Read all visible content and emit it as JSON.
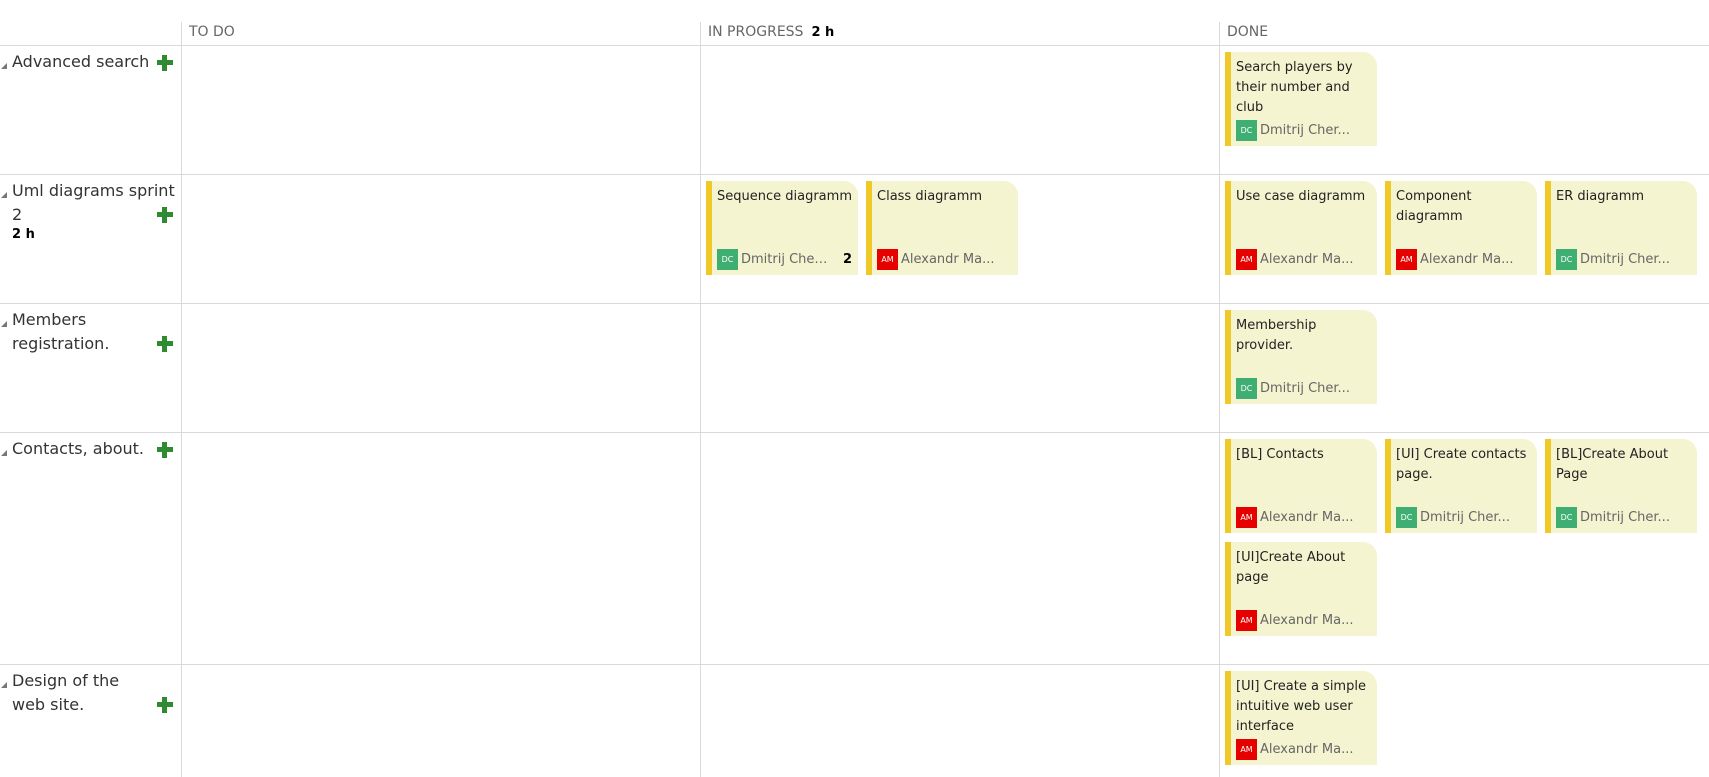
{
  "columns": [
    {
      "label": "TO DO",
      "hours": ""
    },
    {
      "label": "IN PROGRESS",
      "hours": "2 h"
    },
    {
      "label": "DONE",
      "hours": ""
    }
  ],
  "stories": [
    {
      "title": "Advanced search",
      "hours": ""
    },
    {
      "title": "Uml diagrams sprint 2",
      "hours": "2 h"
    },
    {
      "title": "Members registration.",
      "hours": ""
    },
    {
      "title": "Contacts, about.",
      "hours": ""
    },
    {
      "title": "Design of the web site.",
      "hours": ""
    }
  ],
  "tasks": {
    "t1": {
      "title": "Search players by their number and club",
      "owner": "Dmitrij Cher...",
      "initials": "DC",
      "status": "done"
    },
    "t2": {
      "title": "Sequence diagramm",
      "owner": "Dmitrij Cher...",
      "initials": "DC",
      "remaining": "2",
      "status": "in-progress"
    },
    "t3": {
      "title": "Class diagramm",
      "owner": "Alexandr Ma...",
      "initials": "AM",
      "status": "in-progress"
    },
    "t4": {
      "title": "Use case diagramm",
      "owner": "Alexandr Ma...",
      "initials": "AM",
      "status": "done"
    },
    "t5": {
      "title": "Component diagramm",
      "owner": "Alexandr Ma...",
      "initials": "AM",
      "status": "done"
    },
    "t6": {
      "title": "ER diagramm",
      "owner": "Dmitrij Cher...",
      "initials": "DC",
      "status": "done"
    },
    "t7": {
      "title": "Membership provider.",
      "owner": "Dmitrij Cher...",
      "initials": "DC",
      "status": "done"
    },
    "t8": {
      "title": "[BL] Contacts",
      "owner": "Alexandr Ma...",
      "initials": "AM",
      "status": "done"
    },
    "t9": {
      "title": "[UI] Create contacts page.",
      "owner": "Dmitrij Cher...",
      "initials": "DC",
      "status": "done"
    },
    "t10": {
      "title": "[BL]Create About Page",
      "owner": "Dmitrij Cher...",
      "initials": "DC",
      "status": "done"
    },
    "t11": {
      "title": "[UI]Create About page",
      "owner": "Alexandr Ma...",
      "initials": "AM",
      "status": "done"
    },
    "t12": {
      "title": "[UI] Create a simple intuitive web user interface",
      "owner": "Alexandr Ma...",
      "initials": "AM",
      "status": "done"
    }
  },
  "colors": {
    "card_background": "#f5f4d0",
    "card_accent": "#f0c929",
    "avatar_dc": "#3fae72",
    "avatar_am": "#e60000",
    "add_icon": "#2e8b32",
    "grid_line": "#d9d9d9"
  }
}
